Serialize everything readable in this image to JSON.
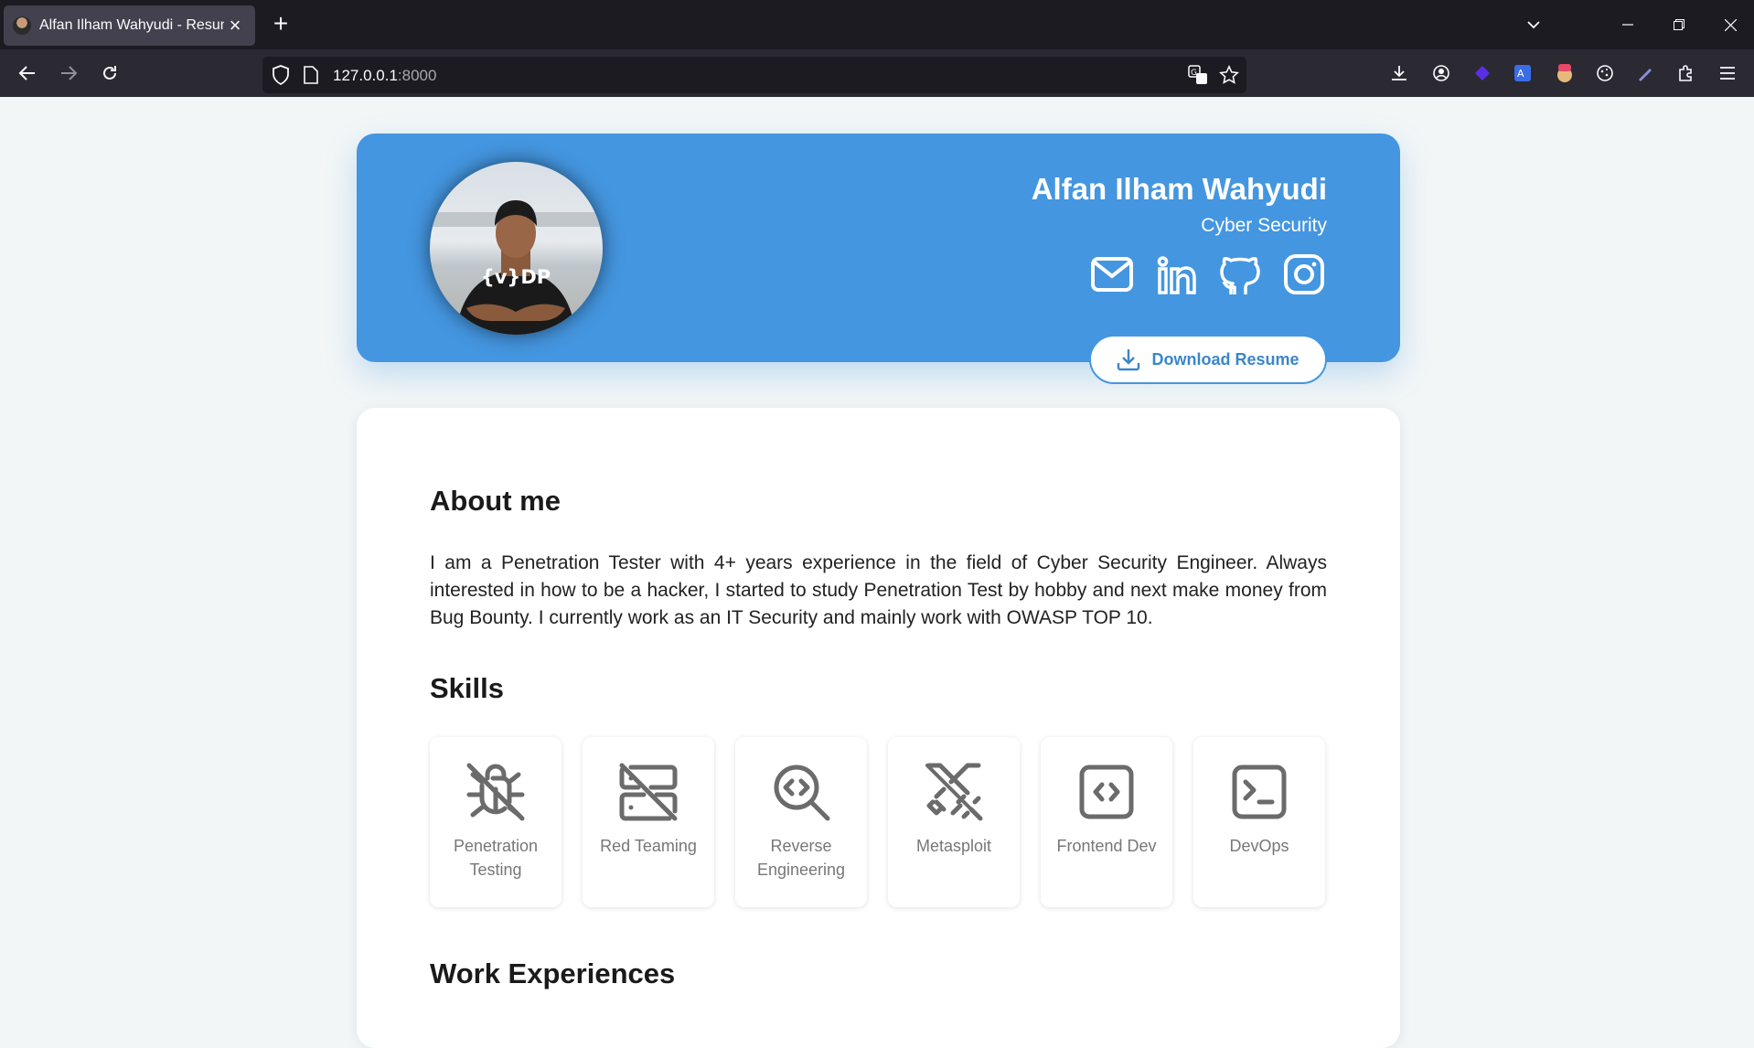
{
  "browser": {
    "tab_title": "Alfan Ilham Wahyudi - Resume",
    "url_host": "127.0.0.1",
    "url_port": ":8000"
  },
  "profile": {
    "name": "Alfan Ilham Wahyudi",
    "role": "Cyber Security",
    "shirt_text": "{v}DP",
    "socials": [
      {
        "icon": "mail-icon"
      },
      {
        "icon": "linkedin-icon"
      },
      {
        "icon": "github-icon"
      },
      {
        "icon": "instagram-icon"
      }
    ],
    "download_label": "Download Resume"
  },
  "about": {
    "heading": "About me",
    "text": "I am a Penetration Tester with 4+ years experience in the field of Cyber Security Engineer. Always interested in how to be a hacker, I started to study Penetration Test by hobby and next make money from Bug Bounty. I currently work as an IT Security and mainly work with OWASP TOP 10."
  },
  "skills": {
    "heading": "Skills",
    "items": [
      {
        "label": "Penetration Testing",
        "icon": "bug-off-icon"
      },
      {
        "label": "Red Teaming",
        "icon": "server-off-icon"
      },
      {
        "label": "Reverse Engineering",
        "icon": "zoom-code-icon"
      },
      {
        "label": "Metasploit",
        "icon": "swords-icon"
      },
      {
        "label": "Frontend Dev",
        "icon": "code-square-icon"
      },
      {
        "label": "DevOps",
        "icon": "terminal-icon"
      }
    ]
  },
  "work": {
    "heading": "Work Experiences"
  },
  "colors": {
    "accent": "#4496e0",
    "page_bg": "#f2f6f7"
  }
}
